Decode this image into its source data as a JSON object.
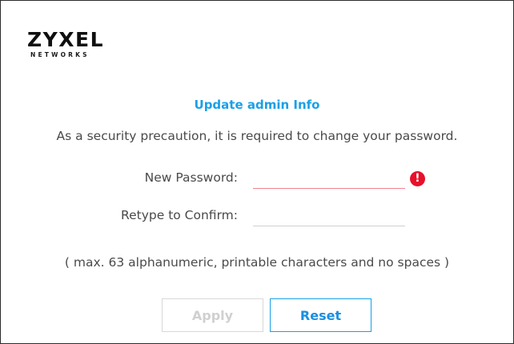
{
  "brand": {
    "logo_main": "ZYXEL",
    "logo_sub": "NETWORKS"
  },
  "form": {
    "title": "Update admin Info",
    "description": "As a security precaution, it is required to change your password.",
    "new_password": {
      "label": "New Password:",
      "value": "",
      "state": "error",
      "alert_icon": "exclamation-circle-icon"
    },
    "confirm_password": {
      "label": "Retype to Confirm:",
      "value": ""
    },
    "hint": "( max. 63 alphanumeric, printable characters and no spaces )",
    "apply_label": "Apply",
    "reset_label": "Reset"
  },
  "colors": {
    "accent": "#1aa0e8",
    "error": "#e8102a",
    "error_underline": "#f0828f",
    "text": "#4a4a4a"
  }
}
